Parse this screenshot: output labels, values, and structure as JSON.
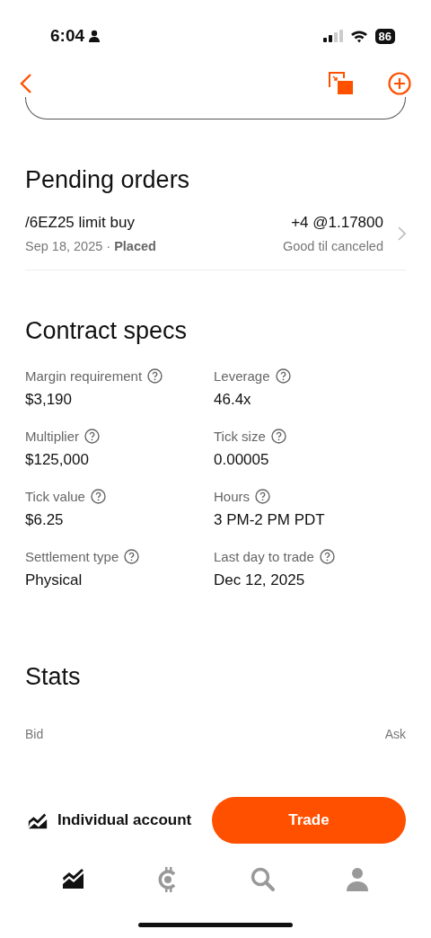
{
  "status_bar": {
    "time": "6:04",
    "battery": "86"
  },
  "pending_orders": {
    "title": "Pending orders",
    "orders": [
      {
        "name": "/6EZ25 limit buy",
        "date": "Sep 18, 2025 · ",
        "status": "Placed",
        "quantity": "+4 @1.17800",
        "duration": "Good til canceled"
      }
    ]
  },
  "contract_specs": {
    "title": "Contract specs",
    "items": [
      {
        "label": "Margin requirement",
        "value": "$3,190"
      },
      {
        "label": "Leverage",
        "value": "46.4x"
      },
      {
        "label": "Multiplier",
        "value": "$125,000"
      },
      {
        "label": "Tick size",
        "value": "0.00005"
      },
      {
        "label": "Tick value",
        "value": "$6.25"
      },
      {
        "label": "Hours",
        "value": "3 PM-2 PM PDT"
      },
      {
        "label": "Settlement type",
        "value": "Physical"
      },
      {
        "label": "Last day to trade",
        "value": "Dec 12, 2025"
      }
    ]
  },
  "stats": {
    "title": "Stats",
    "columns": [
      "Bid",
      "Ask"
    ]
  },
  "action_bar": {
    "account": "Individual account",
    "button": "Trade"
  },
  "tab_bar": [
    {
      "kind": "chart",
      "selected": true
    },
    {
      "kind": "crypto",
      "selected": false
    },
    {
      "kind": "search",
      "selected": false
    },
    {
      "kind": "profile",
      "selected": false
    }
  ]
}
